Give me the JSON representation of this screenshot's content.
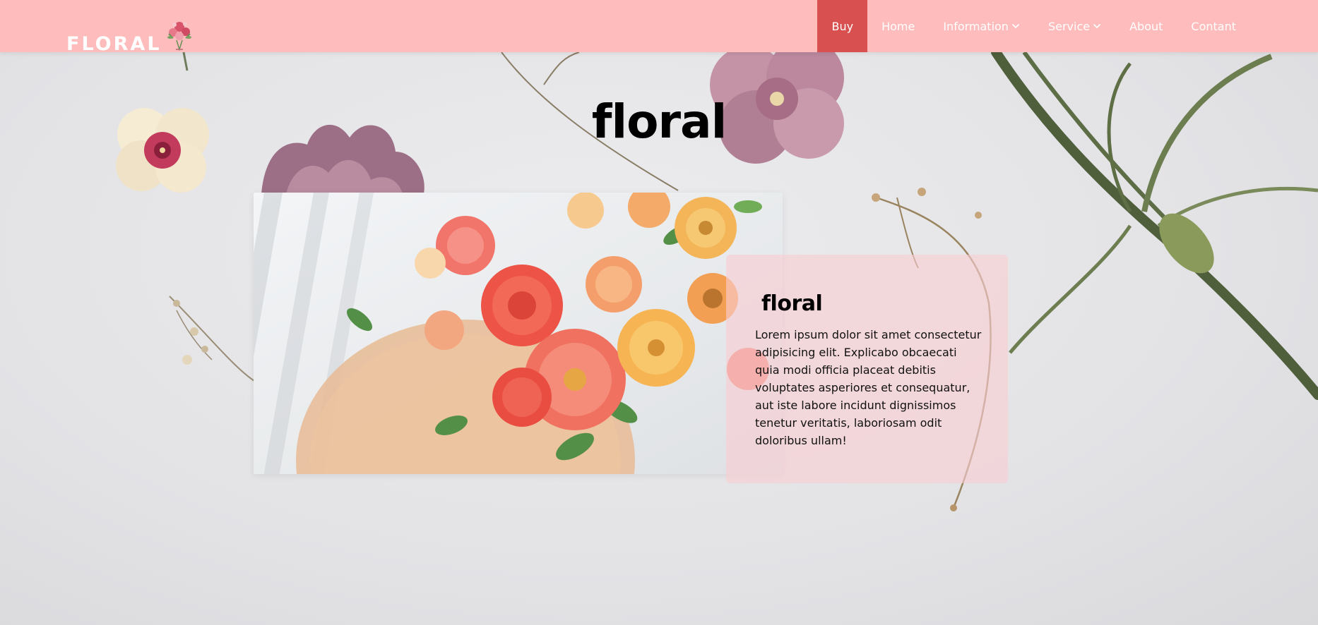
{
  "brand": {
    "name": "FLORAL",
    "logo_icon": "flower-bouquet-icon"
  },
  "nav": {
    "items": [
      {
        "label": "Buy",
        "active": true,
        "dropdown": false
      },
      {
        "label": "Home",
        "active": false,
        "dropdown": false
      },
      {
        "label": "Information",
        "active": false,
        "dropdown": true
      },
      {
        "label": "Service",
        "active": false,
        "dropdown": true
      },
      {
        "label": "About",
        "active": false,
        "dropdown": false
      },
      {
        "label": "Contant",
        "active": false,
        "dropdown": false
      }
    ]
  },
  "hero": {
    "title": "floral"
  },
  "card": {
    "title": "floral",
    "text": "Lorem ipsum dolor sit amet consectetur adipisicing elit. Explicabo obcaecati quia modi officia placeat debitis voluptates asperiores et consequatur, aut iste labore incidunt dignissimos tenetur veritatis, laboriosam odit doloribus ullam!"
  },
  "colors": {
    "navbar": "#ffbcbc",
    "nav_active": "#d85050",
    "card_bg": "#f8cdd2"
  }
}
